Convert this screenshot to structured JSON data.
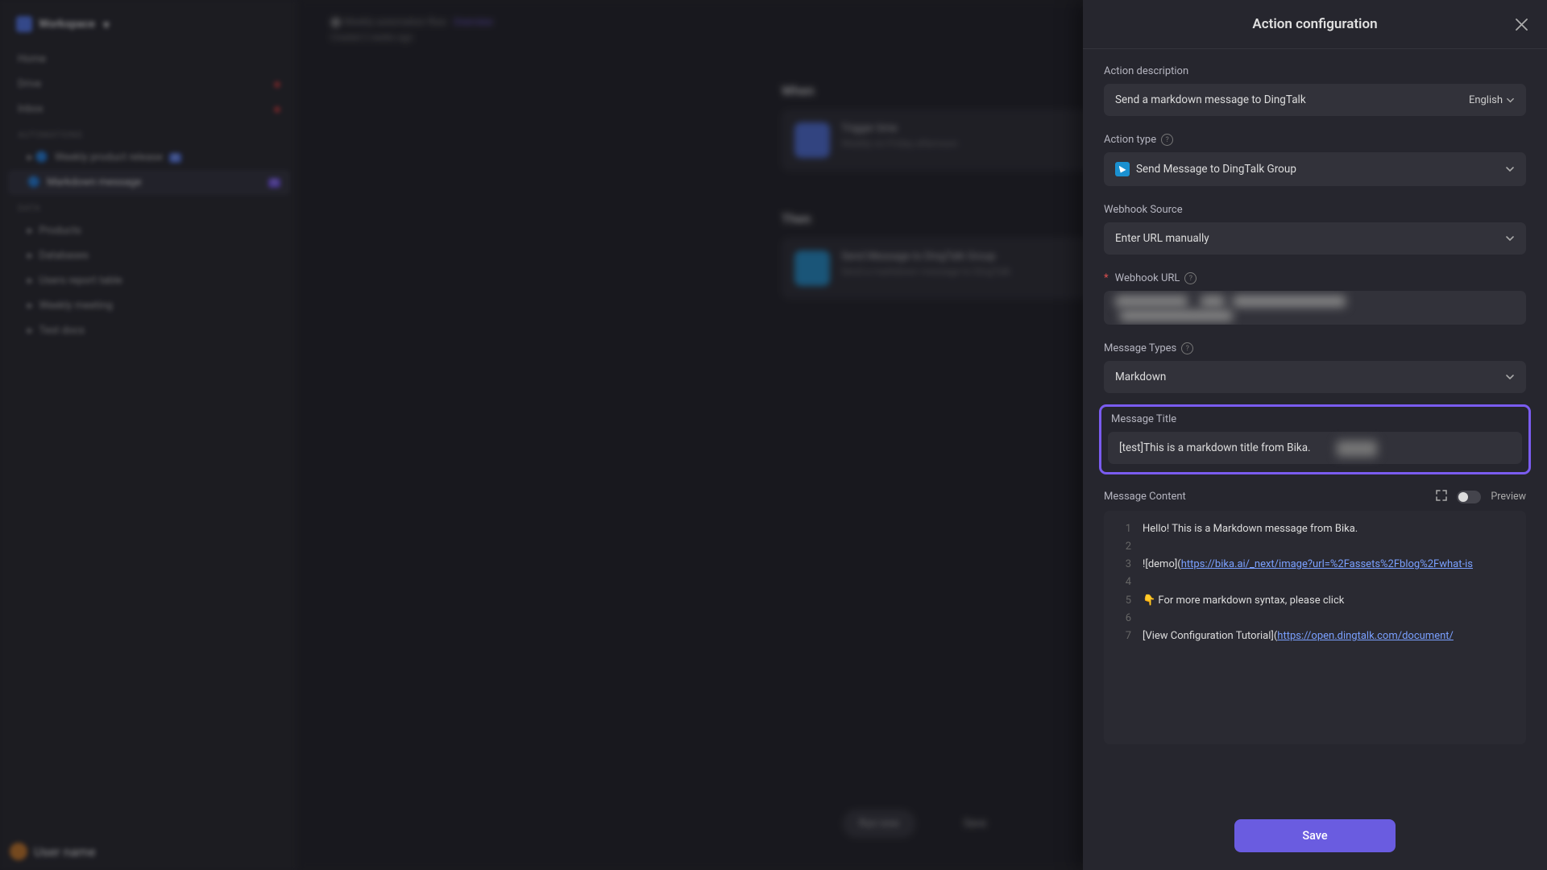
{
  "sidebar": {
    "workspace": "Workspace",
    "items_top": [
      "Home",
      "Drive",
      "Inbox"
    ],
    "section1": "Automations",
    "autom_items": [
      "Weekly product release",
      "Markdown message"
    ],
    "section2": "Data",
    "data_items": [
      "Products",
      "Databases",
      "Users report table",
      "Weekly meeting",
      "Test docs"
    ],
    "footer_user": "User name"
  },
  "main": {
    "breadcrumb_a": "Weekly automation flow",
    "breadcrumb_b": "Overview",
    "subtitle": "Created 2 weeks ago",
    "section_when": "When",
    "section_then": "Then",
    "card1_t": "Trigger time",
    "card1_s": "Weekly on Friday afternoon",
    "card2_t": "Send Message to DingTalk Group",
    "card2_s": "Send a markdown message to DingTalk",
    "run_btn": "Run now",
    "save_btn": "Save"
  },
  "panel": {
    "title": "Action configuration",
    "desc_label": "Action description",
    "desc_value": "Send a markdown message to DingTalk",
    "lang": "English",
    "type_label": "Action type",
    "type_value": "Send Message to DingTalk Group",
    "source_label": "Webhook Source",
    "source_value": "Enter URL manually",
    "url_label": "Webhook URL",
    "msgtypes_label": "Message Types",
    "msgtypes_value": "Markdown",
    "msgtitle_label": "Message Title",
    "msgtitle_value": "[test]This is a markdown title from Bika.",
    "content_label": "Message Content",
    "preview_label": "Preview",
    "code": {
      "l1": "Hello! This is a Markdown message from Bika.",
      "l3a": "![",
      "l3b": "demo",
      "l3c": "](",
      "l3d": "https://bika.ai/_next/image?url=%2Fassets%2Fblog%2Fwhat-is",
      "l5": "👇 For more markdown syntax, please click",
      "l7a": "[",
      "l7b": "View Configuration Tutorial",
      "l7c": "](",
      "l7d": "https://open.dingtalk.com/document/"
    },
    "save": "Save"
  }
}
